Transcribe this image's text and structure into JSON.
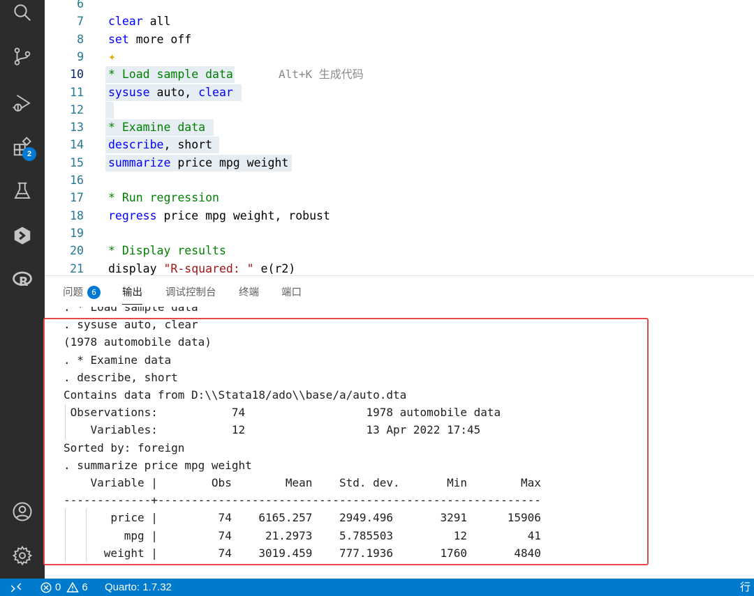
{
  "activity_bar": {
    "icons": [
      "search-icon",
      "source-control-icon",
      "run-debug-icon",
      "extensions-icon",
      "testing-icon",
      "stata-icon",
      "r-language-icon",
      "account-icon",
      "settings-gear-icon"
    ],
    "extensions_badge": "2"
  },
  "editor": {
    "lines": [
      {
        "n": "6",
        "segments": []
      },
      {
        "n": "7",
        "segments": [
          {
            "t": "clear",
            "c": "kw"
          },
          {
            "t": " all",
            "c": "pl"
          }
        ]
      },
      {
        "n": "8",
        "segments": [
          {
            "t": "set",
            "c": "kw"
          },
          {
            "t": " more off",
            "c": "pl"
          }
        ]
      },
      {
        "n": "9",
        "segments": [],
        "sparkle": true
      },
      {
        "n": "10",
        "segments": [
          {
            "t": "* Load sample data",
            "c": "cm"
          }
        ],
        "hint": "Alt+K 生成代码",
        "hl": 185,
        "active": true
      },
      {
        "n": "11",
        "segments": [
          {
            "t": "sysuse",
            "c": "kw"
          },
          {
            "t": " auto, ",
            "c": "pl"
          },
          {
            "t": "clear",
            "c": "kw"
          }
        ],
        "hl": 195
      },
      {
        "n": "12",
        "segments": [],
        "hl": 12
      },
      {
        "n": "13",
        "segments": [
          {
            "t": "* Examine data",
            "c": "cm"
          }
        ],
        "hl": 155
      },
      {
        "n": "14",
        "segments": [
          {
            "t": "describe",
            "c": "kw"
          },
          {
            "t": ", short",
            "c": "pl"
          }
        ],
        "hl": 163
      },
      {
        "n": "15",
        "segments": [
          {
            "t": "summarize",
            "c": "kw"
          },
          {
            "t": " price mpg weight",
            "c": "pl"
          }
        ],
        "hl": 267
      },
      {
        "n": "16",
        "segments": []
      },
      {
        "n": "17",
        "segments": [
          {
            "t": "* Run regression",
            "c": "cm"
          }
        ]
      },
      {
        "n": "18",
        "segments": [
          {
            "t": "regress",
            "c": "kw"
          },
          {
            "t": " price mpg weight, robust",
            "c": "pl"
          }
        ]
      },
      {
        "n": "19",
        "segments": []
      },
      {
        "n": "20",
        "segments": [
          {
            "t": "* Display results",
            "c": "cm"
          }
        ]
      },
      {
        "n": "21",
        "segments": [
          {
            "t": "display",
            "c": "pl"
          },
          {
            "t": " \"R-squared: \"",
            "c": "st"
          },
          {
            "t": " e(r2)",
            "c": "pl"
          }
        ]
      }
    ]
  },
  "panel": {
    "tabs": [
      {
        "label": "问题",
        "badge": "6"
      },
      {
        "label": "输出",
        "active": true
      },
      {
        "label": "调试控制台"
      },
      {
        "label": "终端"
      },
      {
        "label": "端口"
      }
    ],
    "output_lines": [
      ". * Load sample data",
      ". sysuse auto, clear",
      "(1978 automobile data)",
      ". * Examine data",
      ". describe, short",
      "Contains data from D:\\\\Stata18/ado\\\\base/a/auto.dta",
      " Observations:           74                  1978 automobile data",
      "    Variables:           12                  13 Apr 2022 17:45",
      "Sorted by: foreign",
      ". summarize price mpg weight",
      "    Variable |        Obs        Mean    Std. dev.       Min        Max",
      "-------------+---------------------------------------------------------",
      "       price |         74    6165.257    2949.496       3291      15906",
      "         mpg |         74     21.2973    5.785503         12         41",
      "      weight |         74    3019.459    777.1936       1760       4840"
    ]
  },
  "status_bar": {
    "errors": "0",
    "warnings": "6",
    "quarto": "Quarto: 1.7.32",
    "right_text": "行"
  }
}
